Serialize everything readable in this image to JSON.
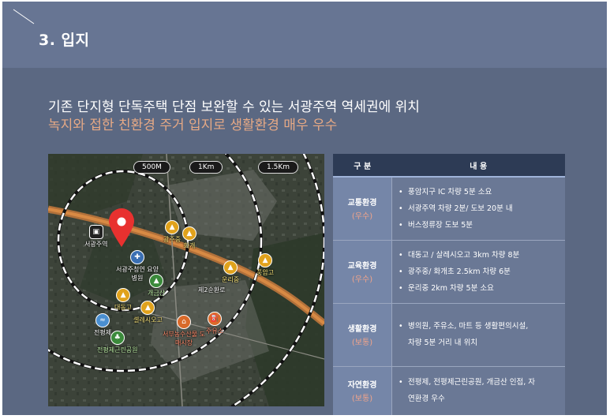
{
  "header": {
    "title": "3. 입지"
  },
  "headline": {
    "line1": "기존 단지형 단독주택 단점 보완할 수 있는 서광주역 역세권에 위치",
    "line2": "녹지와 접한 친환경 주거 입지로 생활환경 매우 우수"
  },
  "map": {
    "distance_labels": [
      "500M",
      "1Km",
      "1.5Km"
    ],
    "pois": [
      {
        "label": "서광주역",
        "icon": "train-icon"
      },
      {
        "label": "서광주청연 요양병원",
        "icon": "hospital-icon"
      },
      {
        "label": "광주중",
        "icon": "school-icon"
      },
      {
        "label": "화개",
        "icon": "school-icon"
      },
      {
        "label": "운리중",
        "icon": "school-icon"
      },
      {
        "label": "풍암고",
        "icon": "school-icon"
      },
      {
        "label": "개금산",
        "icon": "mountain-icon"
      },
      {
        "label": "대동고",
        "icon": "school-icon"
      },
      {
        "label": "셀레시오고",
        "icon": "school-icon"
      },
      {
        "label": "전평제",
        "icon": "lake-icon"
      },
      {
        "label": "전평제근린공원",
        "icon": "park-icon"
      },
      {
        "label": "서부농수산물 도매시장",
        "icon": "market-icon"
      },
      {
        "label": "주유소",
        "icon": "gas-station-icon"
      },
      {
        "label": "제2순환로",
        "icon": "road-label"
      }
    ]
  },
  "table": {
    "headers": [
      "구   분",
      "내   용"
    ],
    "rows": [
      {
        "category": "교통환경",
        "grade": "(우수)",
        "items": [
          "풍암지구 IC 차량 5분 소요",
          "서광주역 차량 2분/ 도보 20분 내",
          "버스정류장 도보 5분"
        ]
      },
      {
        "category": "교육환경",
        "grade": "(우수)",
        "items": [
          "대동고 / 살레시오고 3km 차량 8분",
          "광주중/ 화개초 2.5km 차량 6분",
          "운리중 2km 차량 5분 소요"
        ]
      },
      {
        "category": "생활환경",
        "grade": "(보통)",
        "items": [
          "병의원, 주유소, 마트 등 생활편의시설,",
          "차량 5분 거리 내 위치"
        ]
      },
      {
        "category": "자연환경",
        "grade": "(보통)",
        "items": [
          "전평제, 전평제근린공원, 개금산 인접, 자",
          "연환경 우수"
        ]
      }
    ]
  },
  "colors": {
    "background": "#5b6882",
    "header": "#677593",
    "accent": "#e6a985",
    "table_header": "#2d3b55",
    "category_cell": "#7586a8",
    "marker": "#e8312f"
  }
}
